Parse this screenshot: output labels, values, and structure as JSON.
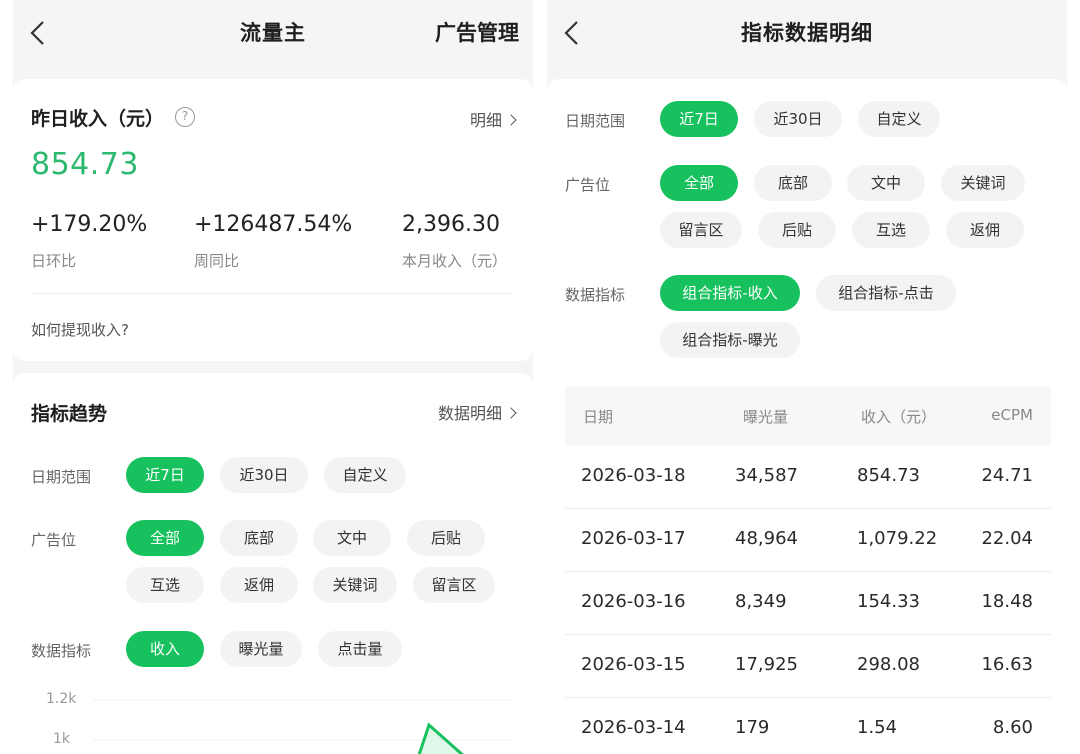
{
  "left": {
    "nav": {
      "title": "流量主",
      "right": "广告管理"
    },
    "income": {
      "title": "昨日收入（元）",
      "help": "?",
      "detail": "明细",
      "amount": "854.73",
      "stats": [
        {
          "value": "+179.20%",
          "label": "日环比"
        },
        {
          "value": "+126487.54%",
          "label": "周同比"
        },
        {
          "value": "2,396.30",
          "label": "本月收入（元）"
        }
      ],
      "howto": "如何提现收入?"
    },
    "trend": {
      "title": "指标趋势",
      "detail": "数据明细",
      "date_label": "日期范围",
      "date_chips": [
        "近7日",
        "近30日",
        "自定义"
      ],
      "ad_label": "广告位",
      "ad_chips": [
        "全部",
        "底部",
        "文中",
        "后贴",
        "互选",
        "返佣",
        "关键词",
        "留言区"
      ],
      "metric_label": "数据指标",
      "metric_chips": [
        "收入",
        "曝光量",
        "点击量"
      ],
      "y_ticks": [
        "1.2k",
        "1k"
      ]
    }
  },
  "right": {
    "nav": {
      "title": "指标数据明细"
    },
    "filters": {
      "date_label": "日期范围",
      "date_chips": [
        "近7日",
        "近30日",
        "自定义"
      ],
      "ad_label": "广告位",
      "ad_chips": [
        "全部",
        "底部",
        "文中",
        "关键词",
        "留言区",
        "后贴",
        "互选",
        "返佣"
      ],
      "metric_label": "数据指标",
      "metric_chips": [
        "组合指标-收入",
        "组合指标-点击",
        "组合指标-曝光"
      ]
    },
    "table": {
      "headers": [
        "日期",
        "曝光量",
        "收入（元）",
        "eCPM"
      ],
      "rows": [
        [
          "2026-03-18",
          "34,587",
          "854.73",
          "24.71"
        ],
        [
          "2026-03-17",
          "48,964",
          "1,079.22",
          "22.04"
        ],
        [
          "2026-03-16",
          "8,349",
          "154.33",
          "18.48"
        ],
        [
          "2026-03-15",
          "17,925",
          "298.08",
          "16.63"
        ],
        [
          "2026-03-14",
          "179",
          "1.54",
          "8.60"
        ]
      ]
    }
  },
  "colors": {
    "accent": "#17c15e",
    "income_green": "#2db870"
  }
}
